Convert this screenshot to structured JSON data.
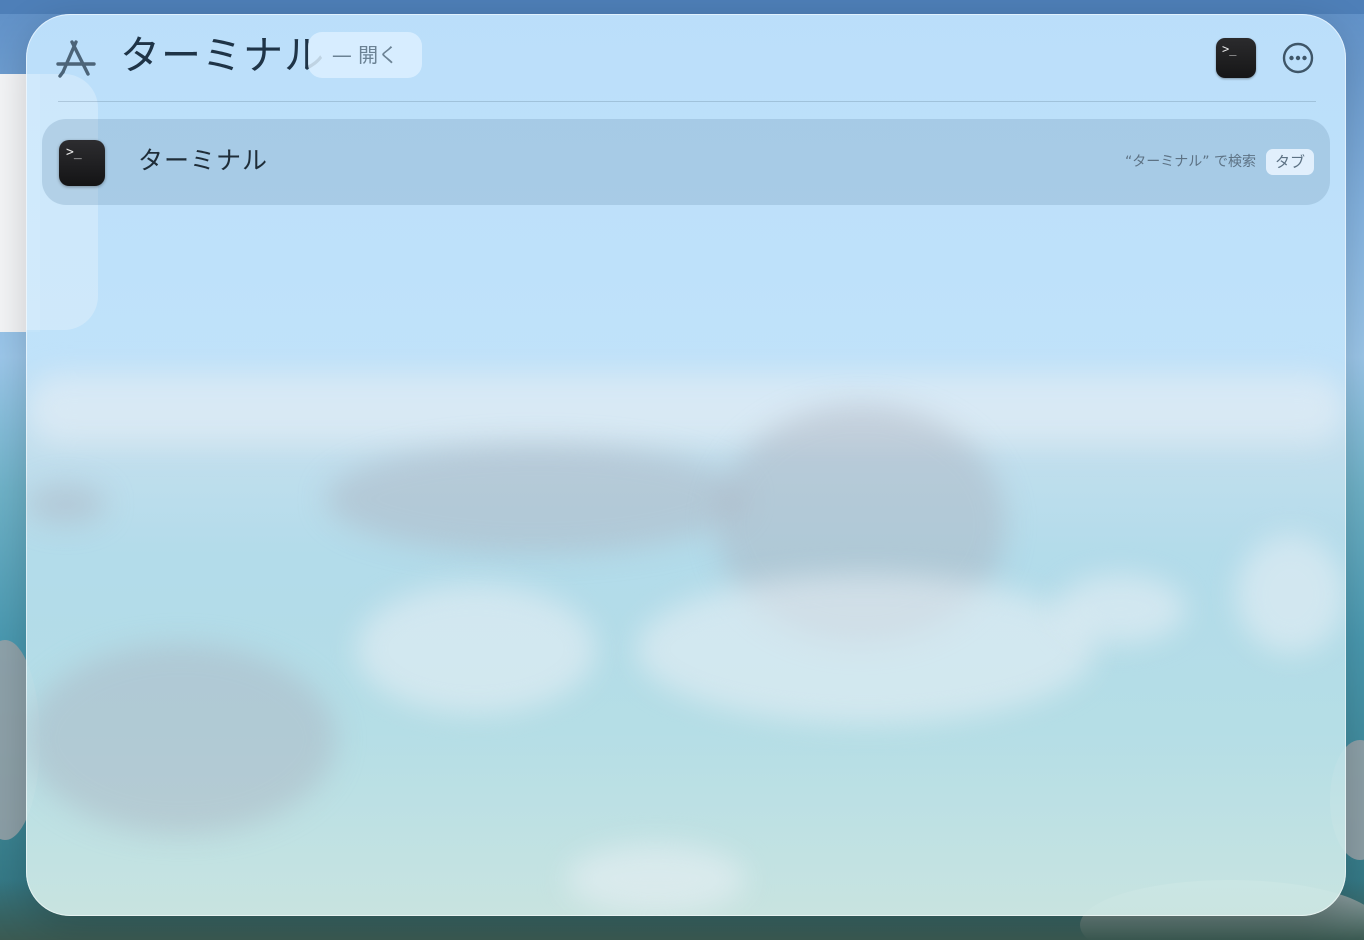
{
  "search": {
    "query": "ターミナル",
    "action_hint": "— 開く",
    "leading_icon": "app-store-icon",
    "preview_icon": "terminal-icon",
    "more_icon": "ellipsis-circle-icon"
  },
  "results": [
    {
      "title": "ターミナル",
      "icon": "terminal-icon",
      "hint": "“ターミナル” で検索",
      "key_badge": "タブ"
    }
  ],
  "terminal_glyph": ">_",
  "colors": {
    "panel_tint": "#bfe2fb",
    "text_primary": "#1f3447",
    "text_secondary": "#5d7284",
    "terminal_bg": "#1c1c1e"
  }
}
